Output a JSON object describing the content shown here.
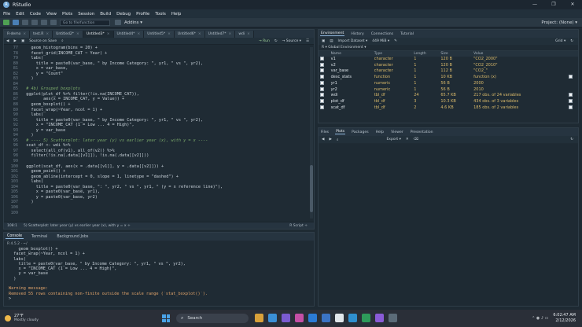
{
  "window": {
    "title": "RStudio",
    "minimize": "—",
    "maximize": "❐",
    "close": "✕"
  },
  "menu": [
    "File",
    "Edit",
    "Code",
    "View",
    "Plots",
    "Session",
    "Build",
    "Debug",
    "Profile",
    "Tools",
    "Help"
  ],
  "toolbar": {
    "goto_placeholder": "Go to file/function",
    "addins": "Addins ▾",
    "project": "Project: (None) ▾"
  },
  "editor": {
    "tabs": [
      {
        "label": "R-demo"
      },
      {
        "label": "test.R"
      },
      {
        "label": "Untitled2*"
      },
      {
        "label": "Untitled3*"
      },
      {
        "label": "Untitled4*"
      },
      {
        "label": "Untitled5*"
      },
      {
        "label": "Untitled6*"
      },
      {
        "label": "Untitled7*"
      },
      {
        "label": "wdi"
      }
    ],
    "toolbar": {
      "source_on_save": "Source on Save",
      "run": "→ Run",
      "source": "→ Source ▾"
    },
    "lines": [
      {
        "n": "77",
        "t": "    geom_histogram(bins = 20) +",
        "c": false
      },
      {
        "n": "78",
        "t": "    facet_grid(INCOME_CAT ~ Year) +",
        "c": false
      },
      {
        "n": "79",
        "t": "    labs(",
        "c": false
      },
      {
        "n": "80",
        "t": "      title = paste0(var_base, \" by Income Category: \", yr1, \" vs \", yr2),",
        "c": false
      },
      {
        "n": "81",
        "t": "      x = var_base,",
        "c": false
      },
      {
        "n": "82",
        "t": "      y = \"Count\"",
        "c": false
      },
      {
        "n": "83",
        "t": "    )",
        "c": false
      },
      {
        "n": "84",
        "t": "",
        "c": false
      },
      {
        "n": "85",
        "t": "  # 4b) Grouped boxplots",
        "c": true
      },
      {
        "n": "86",
        "t": "  ggplot(plot_df %>% filter(!is.na(INCOME_CAT)),",
        "c": false
      },
      {
        "n": "87",
        "t": "         aes(x = INCOME_CAT, y = Value)) +",
        "c": false
      },
      {
        "n": "88",
        "t": "    geom_boxplot() +",
        "c": false
      },
      {
        "n": "89",
        "t": "    facet_wrap(~Year, ncol = 1) +",
        "c": false
      },
      {
        "n": "90",
        "t": "    labs(",
        "c": false
      },
      {
        "n": "91",
        "t": "      title = paste0(var_base, \" by Income Category: \", yr1, \" vs \", yr2),",
        "c": false
      },
      {
        "n": "92",
        "t": "      x = \"INCOME_CAT (1 = Low ... 4 = High)\",",
        "c": false
      },
      {
        "n": "93",
        "t": "      y = var_base",
        "c": false
      },
      {
        "n": "94",
        "t": "    )",
        "c": false
      },
      {
        "n": "95",
        "t": "  # ---- 5) Scatterplot: later year (y) vs earlier year (x), with y = x ----",
        "c": true
      },
      {
        "n": "96",
        "t": "  scat_df <- wdi %>%",
        "c": false
      },
      {
        "n": "97",
        "t": "    select(all_of(v1), all_of(v2)) %>%",
        "c": false
      },
      {
        "n": "98",
        "t": "    filter(!is.na(.data[[v1]]), !is.na(.data[[v2]]))",
        "c": false
      },
      {
        "n": "99",
        "t": "",
        "c": false
      },
      {
        "n": "100",
        "t": "  ggplot(scat_df, aes(x = .data[[v1]], y = .data[[v2]])) +",
        "c": false
      },
      {
        "n": "101",
        "t": "    geom_point() +",
        "c": false
      },
      {
        "n": "102",
        "t": "    geom_abline(intercept = 0, slope = 1, linetype = \"dashed\") +",
        "c": false
      },
      {
        "n": "103",
        "t": "    labs(",
        "c": false
      },
      {
        "n": "104",
        "t": "      title = paste0(var_base, \": \", yr2, \" vs \", yr1, \" (y = x reference line)\"),",
        "c": false
      },
      {
        "n": "105",
        "t": "      x = paste0(var_base, yr1),",
        "c": false
      },
      {
        "n": "106",
        "t": "      y = paste0(var_base, yr2)",
        "c": false
      },
      {
        "n": "107",
        "t": "    )",
        "c": false
      },
      {
        "n": "108",
        "t": "",
        "c": false
      },
      {
        "n": "109",
        "t": "",
        "c": false
      }
    ],
    "status": {
      "position": "108:1",
      "context": "5) Scatterplot: later year (y) vs earlier year (x), with y = x ÷",
      "type": "R Script ÷"
    }
  },
  "console": {
    "tabs": [
      "Console",
      "Terminal",
      "Background Jobs"
    ],
    "path": "R 4.5.2 · ~/",
    "lines": [
      {
        "t": "    geom_boxplot() +",
        "w": false
      },
      {
        "t": "  facet_wrap(~Year, ncol = 1) +",
        "w": false
      },
      {
        "t": "  labs(",
        "w": false
      },
      {
        "t": "    title = paste0(var_base, \" by Income Category: \", yr1, \" vs \", yr2),",
        "w": false
      },
      {
        "t": "    x = \"INCOME_CAT (1 = Low ... 4 = High)\",",
        "w": false
      },
      {
        "t": "    y = var_base",
        "w": false
      },
      {
        "t": "  )",
        "w": false
      },
      {
        "t": "",
        "w": false
      },
      {
        "t": "Warning message:",
        "w": true
      },
      {
        "t": "Removed 55 rows containing non-finite outside the scale range (`stat_boxplot()`).",
        "w": true
      },
      {
        "t": ">",
        "w": false
      }
    ]
  },
  "environment": {
    "tabs": [
      "Environment",
      "History",
      "Connections",
      "Tutorial"
    ],
    "toolbar": {
      "import": "Import Dataset ▾",
      "memory": "449 MiB ▾",
      "view": "Grid ▾"
    },
    "scope": "R ▾   Global Environment ▾",
    "columns": [
      "Name",
      "Type",
      "Length",
      "Size",
      "Value"
    ],
    "rows": [
      {
        "name": "v1",
        "type": "character",
        "len": "1",
        "size": "120 B",
        "value": "\"CO2_2000\""
      },
      {
        "name": "v2",
        "type": "character",
        "len": "1",
        "size": "120 B",
        "value": "\"CO2_2010\""
      },
      {
        "name": "var_base",
        "type": "character",
        "len": "1",
        "size": "112 B",
        "value": "\"CO2_\""
      },
      {
        "name": "desc_stats",
        "type": "function",
        "len": "1",
        "size": "10 KB",
        "value": "function (x)"
      },
      {
        "name": "yr1",
        "type": "numeric",
        "len": "1",
        "size": "56 B",
        "value": "2000"
      },
      {
        "name": "yr2",
        "type": "numeric",
        "len": "1",
        "size": "56 B",
        "value": "2010"
      },
      {
        "name": "wdi",
        "type": "tbl_df",
        "len": "24",
        "size": "65.7 KB",
        "value": "217 obs. of 24 variables"
      },
      {
        "name": "plot_df",
        "type": "tbl_df",
        "len": "3",
        "size": "10.3 KB",
        "value": "434 obs. of 3 variables"
      },
      {
        "name": "scat_df",
        "type": "tbl_df",
        "len": "2",
        "size": "4.6 KB",
        "value": "185 obs. of 2 variables"
      }
    ]
  },
  "files": {
    "tabs": [
      "Files",
      "Plots",
      "Packages",
      "Help",
      "Viewer",
      "Presentation"
    ],
    "export": "Export ▾"
  },
  "taskbar": {
    "temp": "27°F",
    "weather": "Mostly cloudy",
    "search": "Search",
    "time": "6:02:47 AM",
    "date": "2/12/2026"
  },
  "colors": {
    "background": "#1e2a33",
    "accent": "#8fb6db",
    "warning": "#e0a36a"
  }
}
